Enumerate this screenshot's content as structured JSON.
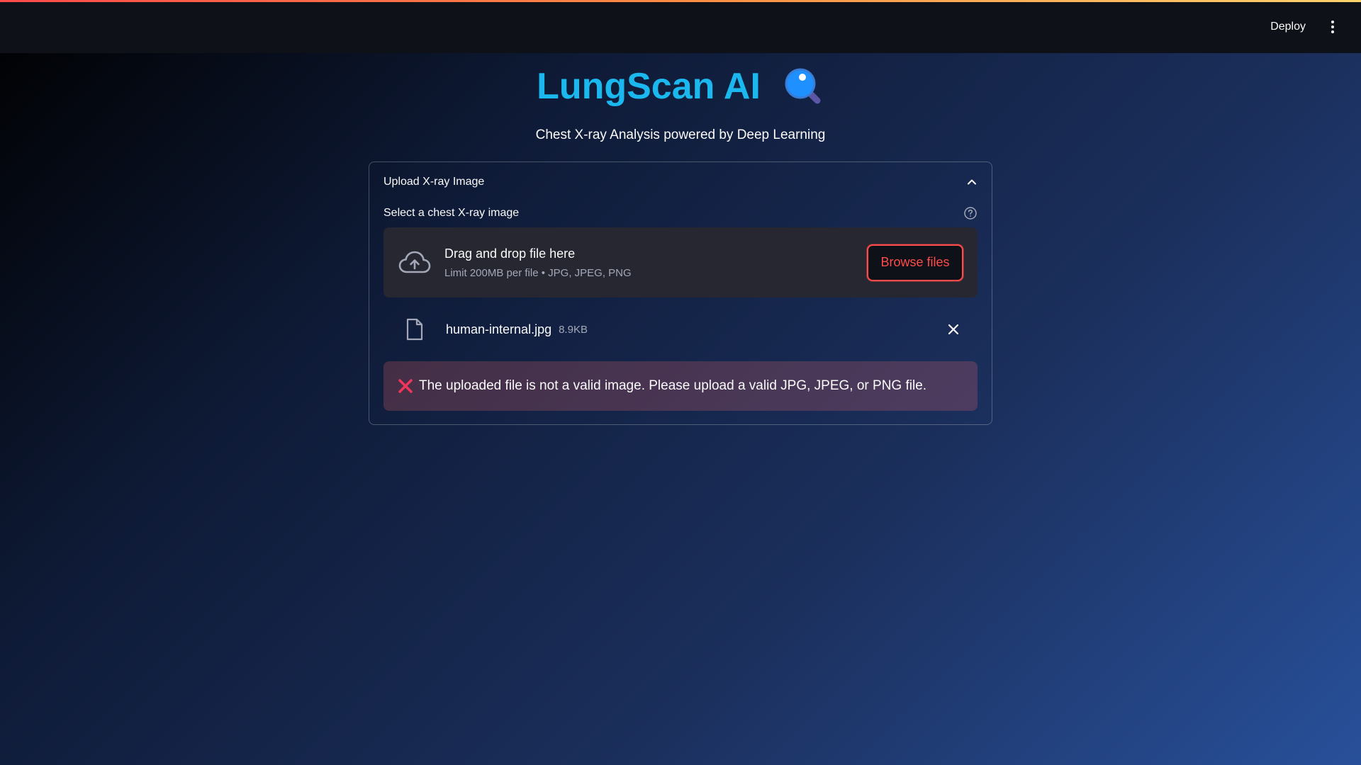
{
  "header": {
    "deploy_label": "Deploy",
    "menu_icon": "more-vertical-icon"
  },
  "main": {
    "title": "LungScan AI",
    "title_icon": "magnifying-glass-icon",
    "subtitle": "Chest X-ray Analysis powered by Deep Learning"
  },
  "expander": {
    "title": "Upload X-ray Image",
    "state": "expanded",
    "uploader": {
      "label": "Select a chest X-ray image",
      "dropzone_title": "Drag and drop file here",
      "limit_text": "Limit 200MB per file • JPG, JPEG, PNG",
      "browse_label": "Browse files",
      "file": {
        "name": "human-internal.jpg",
        "size": "8.9KB"
      }
    },
    "error": {
      "message": "The uploaded file is not a valid image. Please upload a valid JPG, JPEG, or PNG file."
    }
  },
  "colors": {
    "accent": "#ff4b4b",
    "title": "#1ab8ee",
    "panel": "#262730"
  }
}
